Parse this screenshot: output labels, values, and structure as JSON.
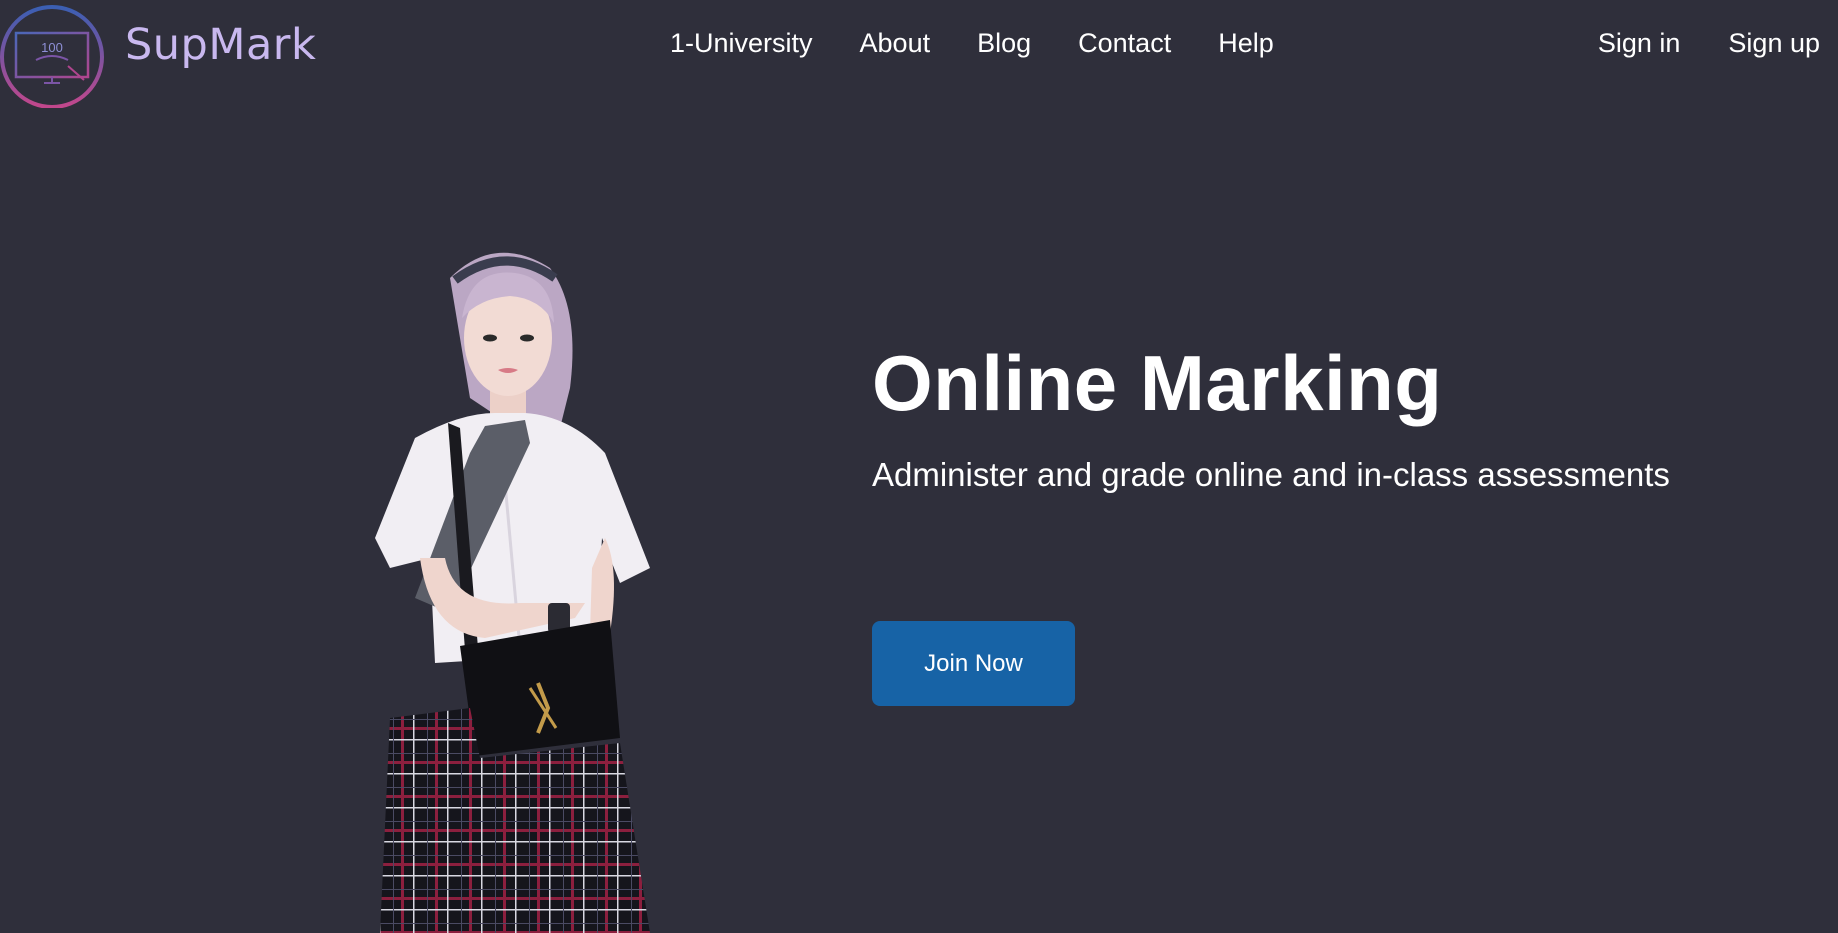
{
  "brand": {
    "name": "SupMark",
    "logo_text": "100",
    "logo_icon": "monitor-icon"
  },
  "nav": {
    "items": [
      {
        "label": "1-University"
      },
      {
        "label": "About"
      },
      {
        "label": "Blog"
      },
      {
        "label": "Contact"
      },
      {
        "label": "Help"
      }
    ]
  },
  "auth": {
    "sign_in": "Sign in",
    "sign_up": "Sign up"
  },
  "hero": {
    "title": "Online Marking",
    "subtitle": "Administer and grade online and in-class assessments",
    "cta_label": "Join Now",
    "image_subject": "person-photo"
  },
  "colors": {
    "background": "#2f2f3b",
    "brand_text": "#c9b8ef",
    "cta": "#1763a6",
    "logo_ring_top": "#3b5fb3",
    "logo_ring_bottom": "#c2478c"
  }
}
